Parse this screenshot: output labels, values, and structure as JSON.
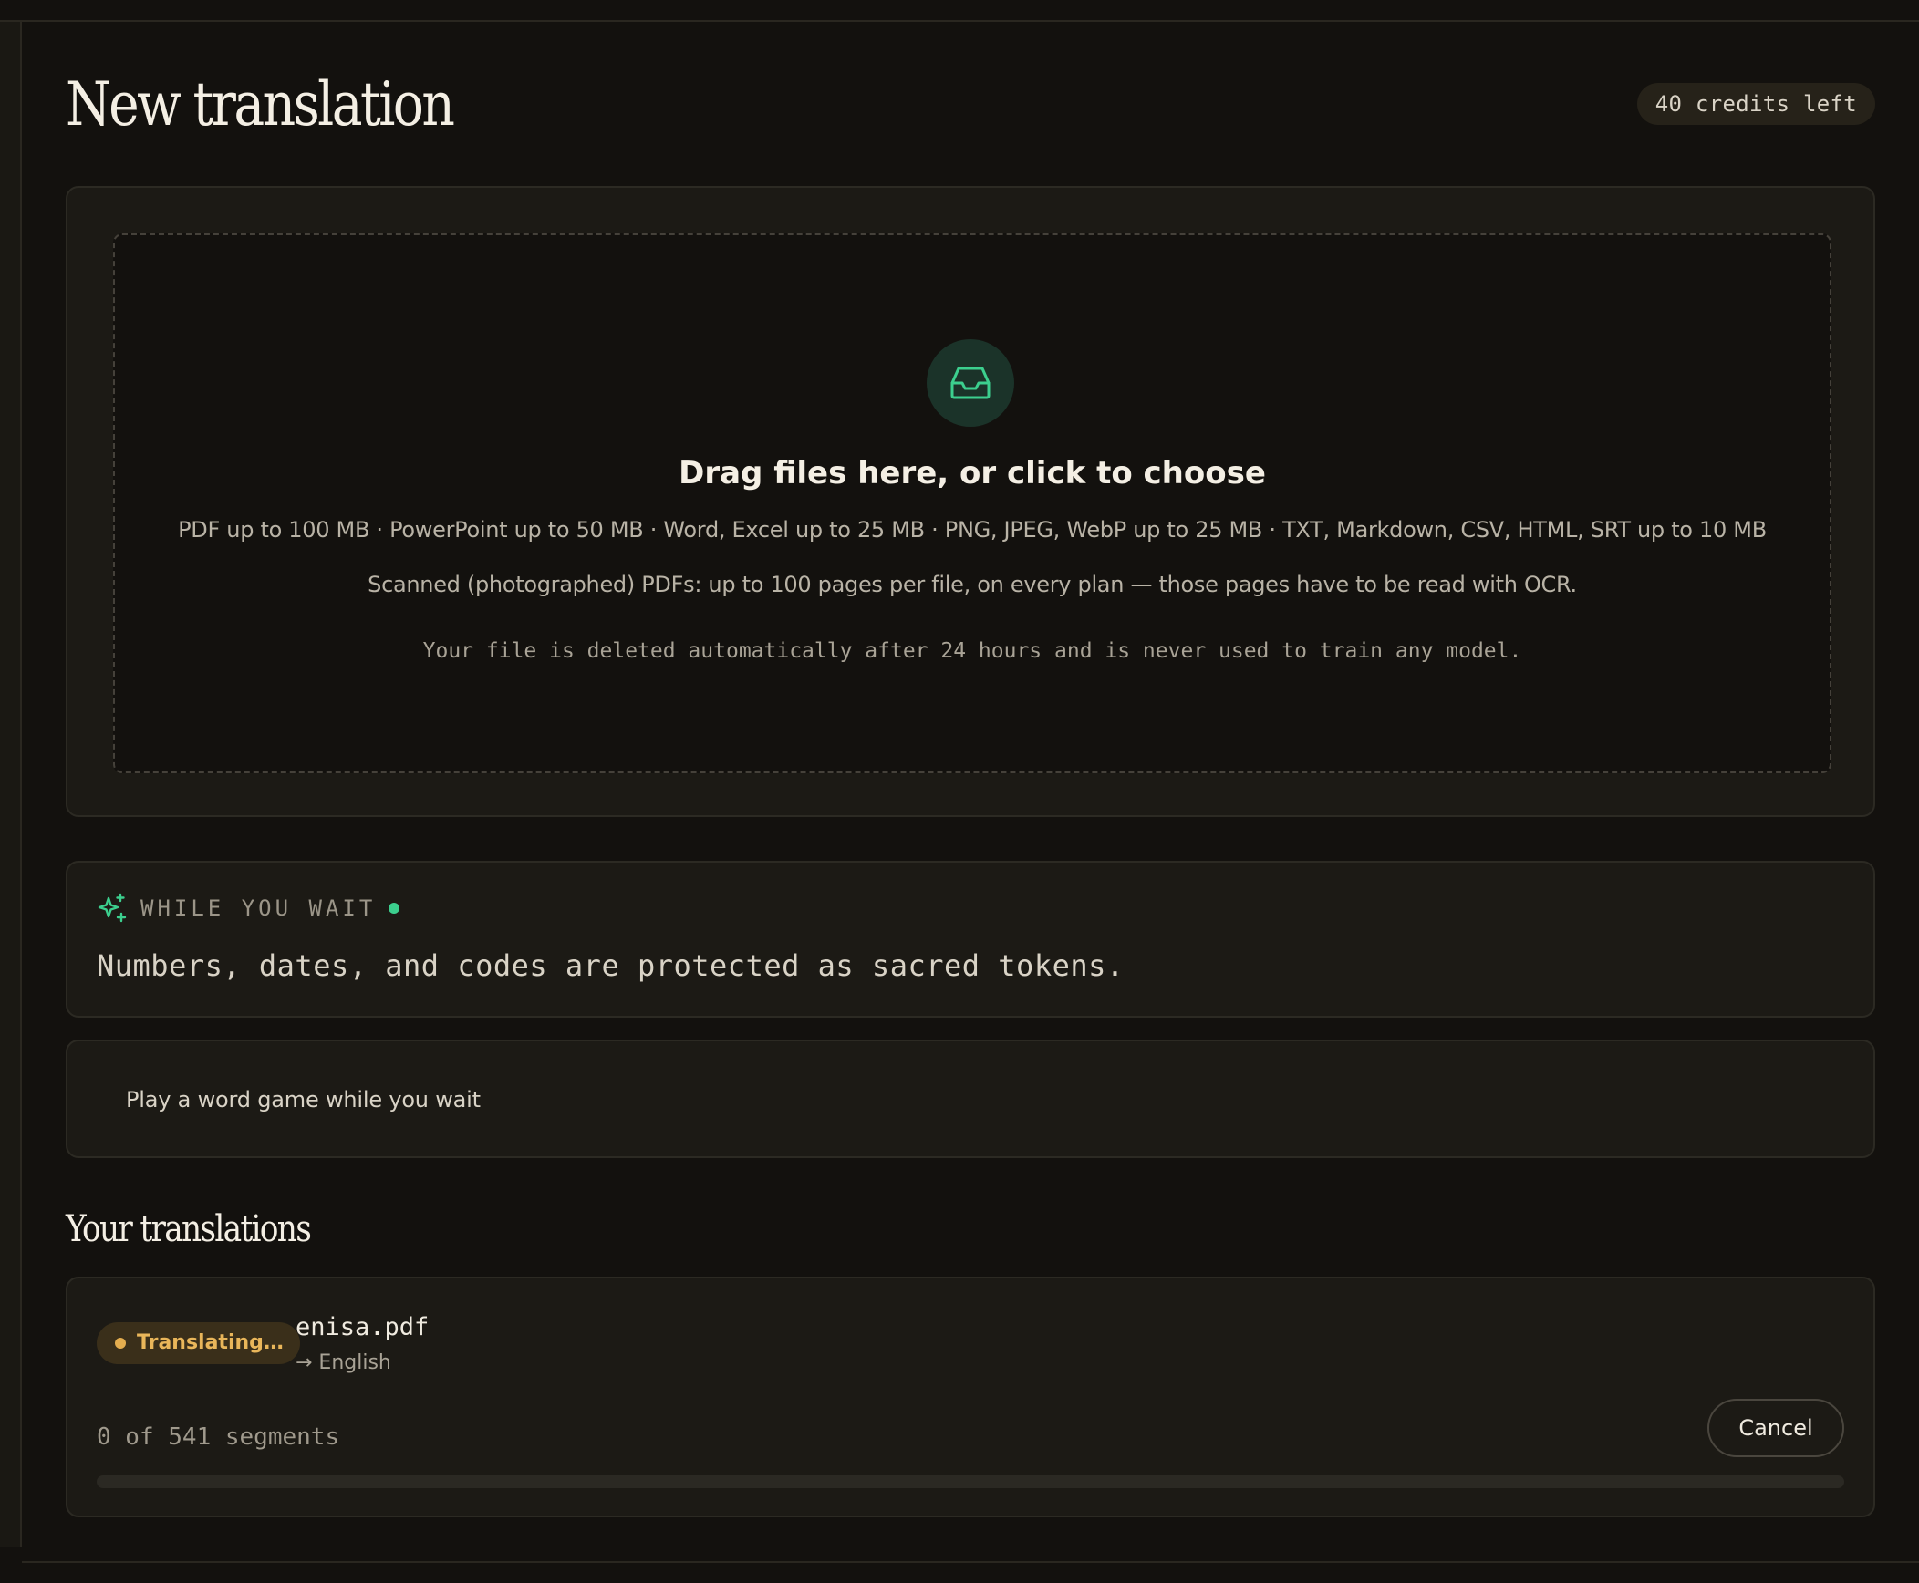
{
  "header": {
    "title": "New translation",
    "credits": "40 credits left"
  },
  "upload": {
    "icon": "inbox-icon",
    "title": "Drag files here, or click to choose",
    "formats": "PDF up to 100 MB · PowerPoint up to 50 MB · Word, Excel up to 25 MB · PNG, JPEG, WebP up to 25 MB · TXT, Markdown, CSV, HTML, SRT up to 10 MB",
    "ocr_note": "Scanned (photographed) PDFs: up to 100 pages per file, on every plan — those pages have to be read with OCR.",
    "privacy_note": "Your file is deleted automatically after 24 hours and is never used to train any model."
  },
  "wait": {
    "icon": "sparkle-icon",
    "label": "WHILE YOU WAIT",
    "tip": "Numbers, dates, and codes are protected as sacred tokens."
  },
  "game": {
    "label": "Play a word game while you wait"
  },
  "translations": {
    "section_title": "Your translations",
    "jobs": [
      {
        "status": "Translating…",
        "file_name": "enisa.pdf",
        "target": "→ English",
        "progress_text": "0 of 541 segments",
        "segments_done": 0,
        "segments_total": 541,
        "cancel_label": "Cancel"
      }
    ]
  },
  "colors": {
    "background": "#13110e",
    "card": "#1c1a15",
    "accent_green": "#3ccf8e",
    "status_amber": "#e9b65a"
  }
}
